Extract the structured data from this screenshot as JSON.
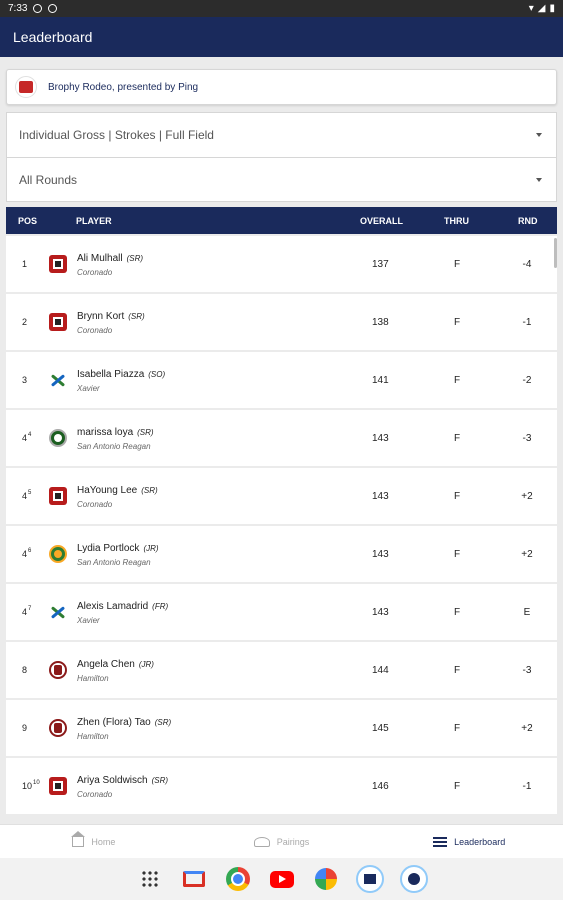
{
  "status": {
    "time": "7:33"
  },
  "header": {
    "title": "Leaderboard"
  },
  "event": {
    "name": "Brophy Rodeo, presented by Ping"
  },
  "filters": {
    "view": "Individual Gross | Strokes | Full Field",
    "rounds": "All Rounds"
  },
  "table": {
    "headers": {
      "pos": "POS",
      "player": "PLAYER",
      "overall": "OVERALL",
      "thru": "THRU",
      "rnd": "RND"
    },
    "rows": [
      {
        "pos": "1",
        "pos_sup": "",
        "name": "Ali Mulhall",
        "year": "(SR)",
        "team": "Coronado",
        "logo": "coronado",
        "overall": "137",
        "thru": "F",
        "rnd": "-4"
      },
      {
        "pos": "2",
        "pos_sup": "",
        "name": "Brynn Kort",
        "year": "(SR)",
        "team": "Coronado",
        "logo": "coronado",
        "overall": "138",
        "thru": "F",
        "rnd": "-1"
      },
      {
        "pos": "3",
        "pos_sup": "",
        "name": "Isabella Piazza",
        "year": "(SO)",
        "team": "Xavier",
        "logo": "xavier",
        "overall": "141",
        "thru": "F",
        "rnd": "-2"
      },
      {
        "pos": "4",
        "pos_sup": "4",
        "name": "marissa loya",
        "year": "(SR)",
        "team": "San Antonio Reagan",
        "logo": "reagan",
        "overall": "143",
        "thru": "F",
        "rnd": "-3"
      },
      {
        "pos": "4",
        "pos_sup": "5",
        "name": "HaYoung Lee",
        "year": "(SR)",
        "team": "Coronado",
        "logo": "coronado",
        "overall": "143",
        "thru": "F",
        "rnd": "+2"
      },
      {
        "pos": "4",
        "pos_sup": "6",
        "name": "Lydia Portlock",
        "year": "(JR)",
        "team": "San Antonio Reagan",
        "logo": "reagan-gold",
        "overall": "143",
        "thru": "F",
        "rnd": "+2"
      },
      {
        "pos": "4",
        "pos_sup": "7",
        "name": "Alexis Lamadrid",
        "year": "(FR)",
        "team": "Xavier",
        "logo": "xavier",
        "overall": "143",
        "thru": "F",
        "rnd": "E"
      },
      {
        "pos": "8",
        "pos_sup": "",
        "name": "Angela Chen",
        "year": "(JR)",
        "team": "Hamilton",
        "logo": "hamilton",
        "overall": "144",
        "thru": "F",
        "rnd": "-3"
      },
      {
        "pos": "9",
        "pos_sup": "",
        "name": "Zhen (Flora) Tao",
        "year": "(SR)",
        "team": "Hamilton",
        "logo": "hamilton",
        "overall": "145",
        "thru": "F",
        "rnd": "+2"
      },
      {
        "pos": "10",
        "pos_sup": "10",
        "name": "Ariya Soldwisch",
        "year": "(SR)",
        "team": "Coronado",
        "logo": "coronado",
        "overall": "146",
        "thru": "F",
        "rnd": "-1"
      }
    ]
  },
  "nav": {
    "home": "Home",
    "pairings": "Pairings",
    "leaderboard": "Leaderboard"
  },
  "taskbar": [
    "apps-grid-icon",
    "gmail-icon",
    "chrome-icon",
    "youtube-icon",
    "photos-icon",
    "app-icon",
    "app-icon"
  ]
}
